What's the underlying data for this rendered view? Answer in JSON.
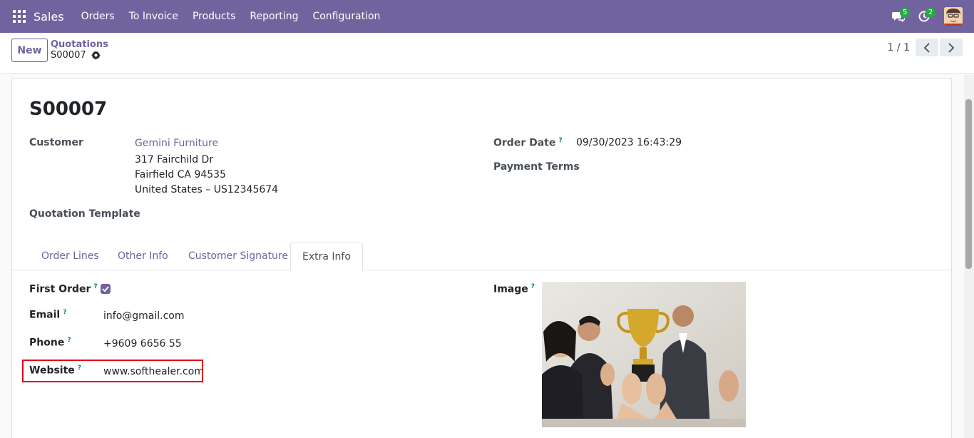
{
  "navbar": {
    "app_name": "Sales",
    "menu": [
      "Orders",
      "To Invoice",
      "Products",
      "Reporting",
      "Configuration"
    ],
    "messages_count": "5",
    "activities_count": "2",
    "colors": {
      "primary": "#71639e",
      "badge": "#28a745"
    }
  },
  "control_panel": {
    "new_label": "New",
    "breadcrumb_parent": "Quotations",
    "breadcrumb_current": "S00007",
    "pager": "1 / 1"
  },
  "form": {
    "title": "S00007",
    "customer_label": "Customer",
    "customer_name": "Gemini Furniture",
    "address_line1": "317 Fairchild Dr",
    "address_line2": "Fairfield CA 94535",
    "address_line3": "United States – US12345674",
    "quotation_template_label": "Quotation Template",
    "order_date_label": "Order Date",
    "order_date_value": "09/30/2023 16:43:29",
    "payment_terms_label": "Payment Terms",
    "help_mark": "?"
  },
  "tabs": [
    "Order Lines",
    "Other Info",
    "Customer Signature",
    "Extra Info"
  ],
  "extra_info": {
    "first_order_label": "First Order",
    "first_order_checked": true,
    "email_label": "Email",
    "email_value": "info@gmail.com",
    "phone_label": "Phone",
    "phone_value": "+9609 6656 55",
    "website_label": "Website",
    "website_value": "www.softhealer.com",
    "image_label": "Image"
  }
}
